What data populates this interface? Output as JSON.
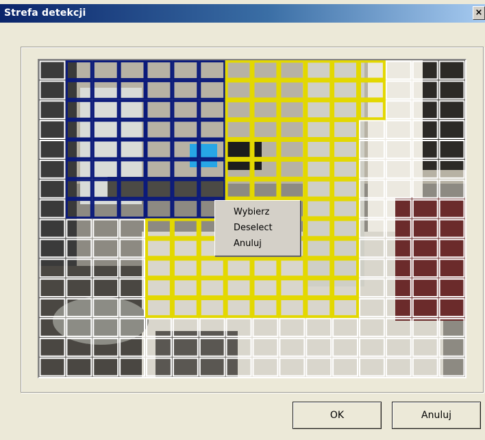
{
  "window": {
    "title": "Strefa detekcji",
    "close_glyph": "×"
  },
  "colors": {
    "titlebar_start": "#0a246a",
    "grid_unselected": "#ffffff",
    "grid_selected_yellow": "#e3d800",
    "grid_selected_blue": "#0b1a7a"
  },
  "context_menu": {
    "items": [
      "Wybierz",
      "Deselect",
      "Anuluj"
    ]
  },
  "buttons": {
    "ok_label": "OK",
    "cancel_label": "Anuluj"
  }
}
